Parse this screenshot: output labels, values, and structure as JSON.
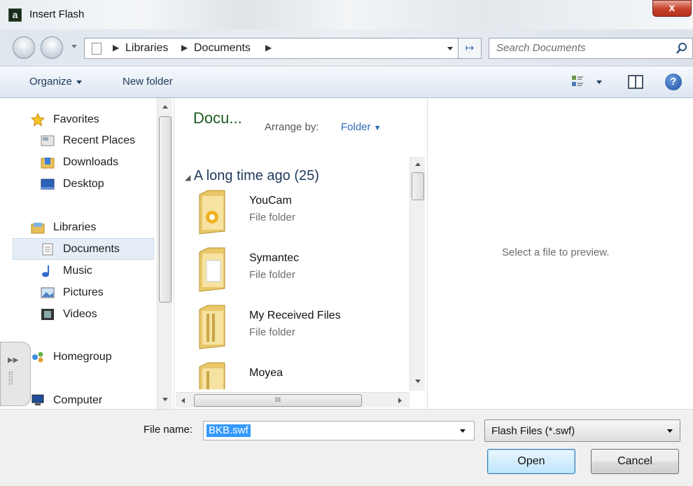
{
  "window": {
    "title": "Insert Flash",
    "close_glyph": "x",
    "app_icon_letter": "a"
  },
  "address": {
    "crumbs": [
      "Libraries",
      "Documents"
    ],
    "search_placeholder": "Search Documents"
  },
  "toolbar": {
    "organize": "Organize",
    "new_folder": "New folder",
    "help_glyph": "?"
  },
  "nav": {
    "favorites": "Favorites",
    "recent_places": "Recent Places",
    "downloads": "Downloads",
    "desktop": "Desktop",
    "libraries": "Libraries",
    "documents": "Documents",
    "music": "Music",
    "pictures": "Pictures",
    "videos": "Videos",
    "homegroup": "Homegroup",
    "computer": "Computer"
  },
  "files": {
    "library_title": "Docu...",
    "arrange_label": "Arrange by:",
    "arrange_value": "Folder",
    "group_header": "A long time ago (25)",
    "items": [
      {
        "name": "YouCam",
        "type": "File folder"
      },
      {
        "name": "Symantec",
        "type": "File folder"
      },
      {
        "name": "My Received Files",
        "type": "File folder"
      },
      {
        "name": "Moyea",
        "type": ""
      }
    ],
    "hscroll_grip": "III"
  },
  "preview": {
    "text": "Select a file to preview."
  },
  "bottom": {
    "file_name_label": "File name:",
    "file_name_value": "BKB.swf",
    "filter": "Flash Files (*.swf)",
    "open": "Open",
    "cancel": "Cancel"
  },
  "icons": [
    "app-icon",
    "back-icon",
    "forward-icon",
    "document-icon",
    "refresh-icon",
    "search-icon",
    "view-options-icon",
    "preview-pane-icon",
    "help-icon",
    "star-icon",
    "recent-places-icon",
    "downloads-icon",
    "desktop-icon",
    "libraries-icon",
    "documents-icon",
    "music-icon",
    "pictures-icon",
    "videos-icon",
    "homegroup-icon",
    "computer-icon",
    "folder-icon"
  ]
}
